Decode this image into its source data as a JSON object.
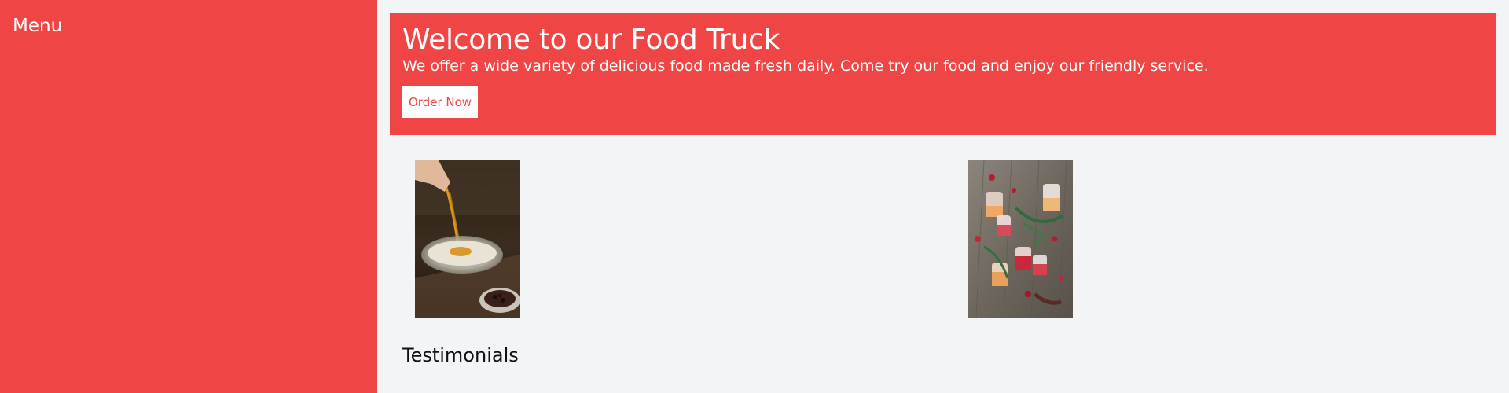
{
  "sidebar": {
    "title": "Menu"
  },
  "hero": {
    "title": "Welcome to our Food Truck",
    "text": "We offer a wide variety of delicious food made fresh daily. Come try our food and enjoy our friendly service.",
    "button_label": "Order Now"
  },
  "gallery": {
    "images": [
      {
        "name": "spice-mixing-photo"
      },
      {
        "name": "drinks-table-photo"
      }
    ]
  },
  "testimonials": {
    "heading": "Testimonials"
  },
  "colors": {
    "brand": "#ef4545",
    "background": "#f3f4f6",
    "button_bg": "#ffffff"
  }
}
